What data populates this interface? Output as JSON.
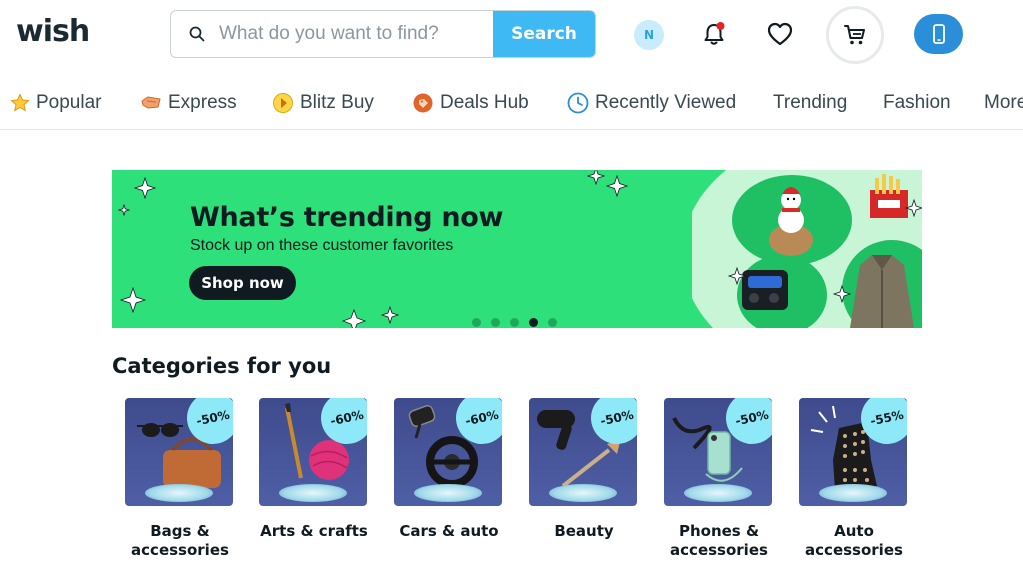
{
  "header": {
    "logo": "wish",
    "search": {
      "placeholder": "What do you want to find?",
      "button_label": "Search"
    },
    "avatar_initial": "N"
  },
  "nav": {
    "items": [
      {
        "label": "Popular",
        "icon": "star-icon"
      },
      {
        "label": "Express",
        "icon": "express-icon"
      },
      {
        "label": "Blitz Buy",
        "icon": "blitz-buy-icon"
      },
      {
        "label": "Deals Hub",
        "icon": "tag-icon"
      },
      {
        "label": "Recently Viewed",
        "icon": "clock-icon"
      },
      {
        "label": "Trending"
      },
      {
        "label": "Fashion"
      },
      {
        "label": "More"
      }
    ]
  },
  "banner": {
    "title": "What’s trending now",
    "subtitle": "Stock up on these customer favorites",
    "button_label": "Shop now",
    "carousel_active_index": 3,
    "carousel_count": 5
  },
  "categories": {
    "title": "Categories for you",
    "items": [
      {
        "label": "Bags & accessories",
        "discount": "-50%"
      },
      {
        "label": "Arts & crafts",
        "discount": "-60%"
      },
      {
        "label": "Cars & auto",
        "discount": "-60%"
      },
      {
        "label": "Beauty",
        "discount": "-50%"
      },
      {
        "label": "Phones & accessories",
        "discount": "-50%"
      },
      {
        "label": "Auto accessories",
        "discount": "-55%"
      }
    ]
  },
  "colors": {
    "accent": "#3fb9f3",
    "banner_bg": "#2ee07a",
    "app_button": "#2a8ed8",
    "notification_dot": "#e8202a"
  }
}
